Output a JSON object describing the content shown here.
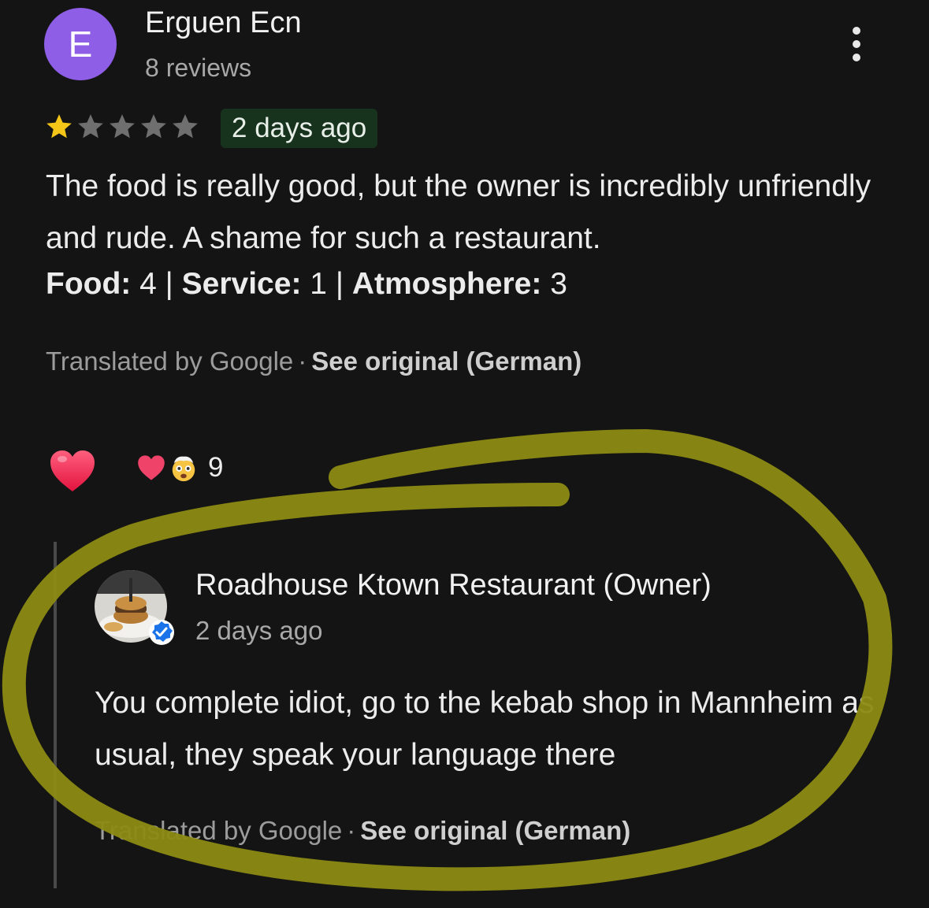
{
  "review": {
    "avatar_letter": "E",
    "reviewer_name": "Erguen Ecn",
    "reviewer_meta": "8 reviews",
    "rating": 1,
    "rating_max": 5,
    "date": "2 days ago",
    "text": "The food is really good, but the owner is incredibly unfriendly and rude. A shame for such a restaurant.",
    "sub_ratings": [
      {
        "label": "Food:",
        "value": "4"
      },
      {
        "label": "Service:",
        "value": "1"
      },
      {
        "label": "Atmosphere:",
        "value": "3"
      }
    ],
    "separator": "|",
    "translated_label": "Translated by Google",
    "dot": "·",
    "see_original": "See original (German)"
  },
  "reactions": {
    "count": "9"
  },
  "owner_reply": {
    "name": "Roadhouse Ktown Restaurant (Owner)",
    "date": "2 days ago",
    "text": "You complete idiot, go to the kebab shop in Mannheim as usual, they speak your language there",
    "translated_label": "Translated by Google",
    "dot": "·",
    "see_original": "See original (German)"
  },
  "colors": {
    "background": "#141414",
    "avatar": "#8e5ee6",
    "star_filled": "#f5c518",
    "star_empty": "#6f6f6f",
    "date_badge": "#17321d",
    "highlight_ring": "#8c8a12",
    "verified": "#1a73e8"
  },
  "icons": {
    "menu": "more-vert-icon",
    "reaction_primary": "heart-icon",
    "reaction_secondary": "exploding-head-icon",
    "verified": "verified-check-icon"
  }
}
